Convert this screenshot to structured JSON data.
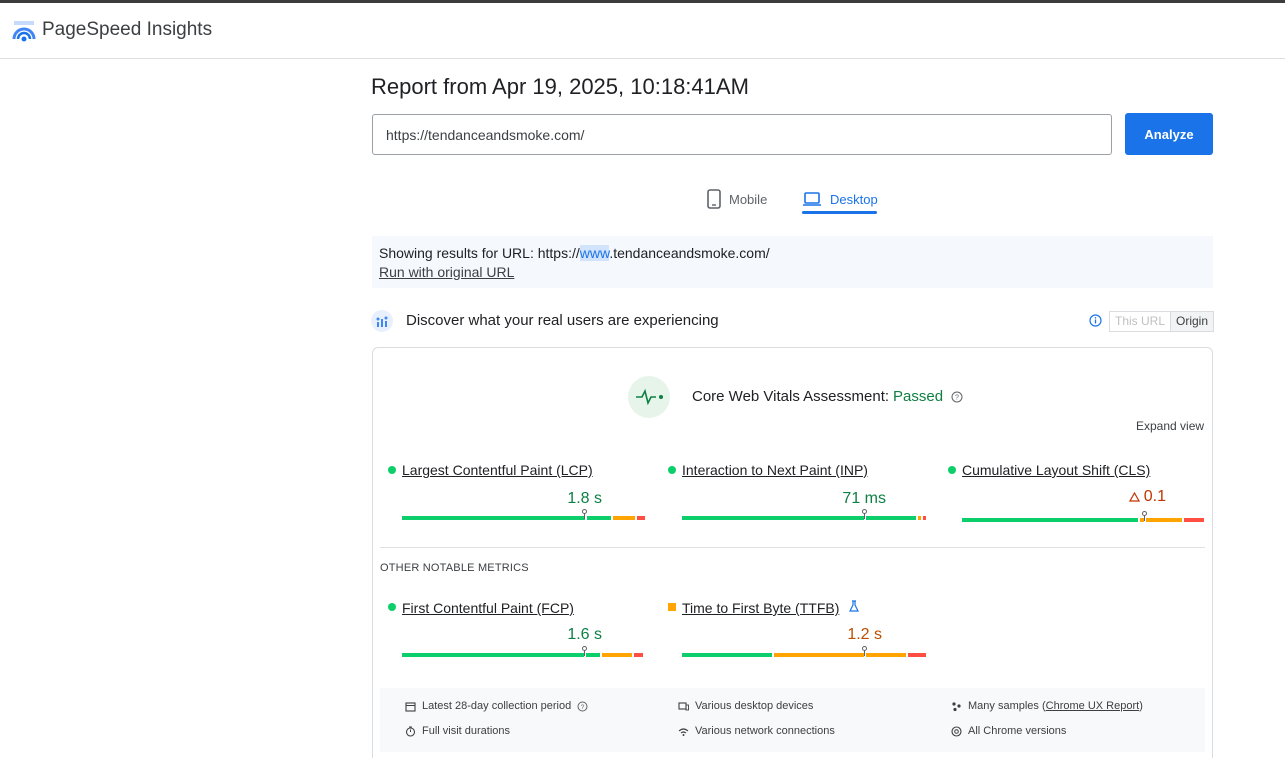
{
  "app": {
    "title": "PageSpeed Insights"
  },
  "report": {
    "title": "Report from Apr 19, 2025, 10:18:41AM"
  },
  "search": {
    "url_value": "https://tendanceandsmoke.com/",
    "analyze_label": "Analyze"
  },
  "tabs": [
    {
      "label": "Mobile",
      "active": false,
      "icon": "phone-icon"
    },
    {
      "label": "Desktop",
      "active": true,
      "icon": "laptop-icon"
    }
  ],
  "notice": {
    "prefix": "Showing results for URL: https://",
    "highlight": "www",
    "suffix": ".tendanceandsmoke.com/",
    "link": "Run with original URL"
  },
  "crux": {
    "title": "Discover what your real users are experiencing",
    "toggle": {
      "this_url": "This URL",
      "origin": "Origin",
      "selected": "Origin"
    }
  },
  "assessment": {
    "label": "Core Web Vitals Assessment:",
    "status": "Passed",
    "expand": "Expand view"
  },
  "core_metrics": [
    {
      "name": "Largest Contentful Paint (LCP)",
      "value": "1.8 s",
      "rating": "good",
      "dist": {
        "good": 0.77,
        "ni": 0.1,
        "poor": 0.04
      }
    },
    {
      "name": "Interaction to Next Paint (INP)",
      "value": "71 ms",
      "rating": "good",
      "dist": {
        "good": 0.96,
        "ni": 0.03,
        "poor": 0.01
      }
    },
    {
      "name": "Cumulative Layout Shift (CLS)",
      "value": "0.1",
      "rating": "needs-improvement",
      "dist": {
        "good": 0.75,
        "ni": 0.16,
        "poor": 0.09
      }
    }
  ],
  "other": {
    "title": "OTHER NOTABLE METRICS",
    "metrics": [
      {
        "name": "First Contentful Paint (FCP)",
        "value": "1.6 s",
        "rating": "good"
      },
      {
        "name": "Time to First Byte (TTFB)",
        "value": "1.2 s",
        "rating": "needs-improvement"
      }
    ]
  },
  "footer": {
    "period": "Latest 28-day collection period",
    "durations": "Full visit durations",
    "devices": "Various desktop devices",
    "connections": "Various network connections",
    "samples_prefix": "Many samples (",
    "samples_link": "Chrome UX Report",
    "samples_suffix": ")",
    "versions": "All Chrome versions"
  },
  "colors": {
    "accent": "#1a73e8",
    "good": "#0cce6b",
    "average": "#ffa400",
    "poor": "#ff4e42",
    "good_text": "#0d8043"
  }
}
